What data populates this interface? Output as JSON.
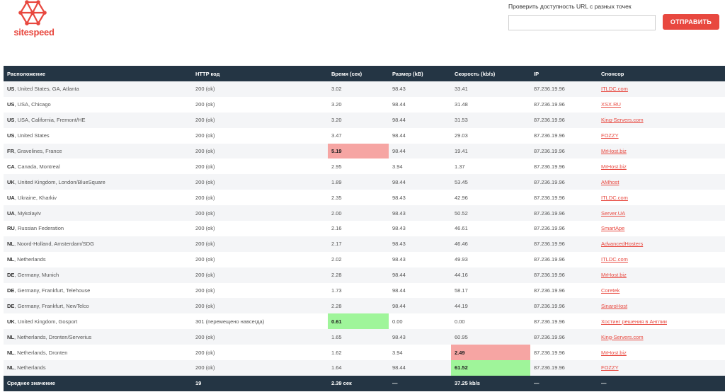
{
  "logo": {
    "text": "sitespeed"
  },
  "check": {
    "label": "Проверить доступность URL с разных точек",
    "input_value": "",
    "input_placeholder": "",
    "button_label": "ОТПРАВИТЬ"
  },
  "colors": {
    "accent": "#e8483f",
    "header_bg": "#243544",
    "highlight_red": "#f6a5a3",
    "highlight_green": "#9ff59a"
  },
  "table": {
    "headers": [
      "Расположение",
      "HTTP код",
      "Время (сек)",
      "Размер (kB)",
      "Скорость (kb/s)",
      "IP",
      "Спонсор"
    ],
    "rows": [
      {
        "cc": "US",
        "loc": ", United States, GA, Atlanta",
        "http": "200 (ok)",
        "time": "3.02",
        "size": "98.43",
        "speed": "33.41",
        "ip": "87.236.19.96",
        "sponsor": "ITLDC.com"
      },
      {
        "cc": "US",
        "loc": ", USA, Chicago",
        "http": "200 (ok)",
        "time": "3.20",
        "size": "98.44",
        "speed": "31.48",
        "ip": "87.236.19.96",
        "sponsor": "XSX.RU"
      },
      {
        "cc": "US",
        "loc": ", USA, California, Fremont/HE",
        "http": "200 (ok)",
        "time": "3.20",
        "size": "98.44",
        "speed": "31.53",
        "ip": "87.236.19.96",
        "sponsor": "King-Servers.com"
      },
      {
        "cc": "US",
        "loc": ", United States",
        "http": "200 (ok)",
        "time": "3.47",
        "size": "98.44",
        "speed": "29.03",
        "ip": "87.236.19.96",
        "sponsor": "FOZZY"
      },
      {
        "cc": "FR",
        "loc": ", Gravelines, France",
        "http": "200 (ok)",
        "time": "5.19",
        "size": "98.44",
        "speed": "19.41",
        "ip": "87.236.19.96",
        "sponsor": "MrHost.biz",
        "time_hl": "red"
      },
      {
        "cc": "CA",
        "loc": ", Canada, Montreal",
        "http": "200 (ok)",
        "time": "2.95",
        "size": "3.94",
        "speed": "1.37",
        "ip": "87.236.19.96",
        "sponsor": "MrHost.biz"
      },
      {
        "cc": "UK",
        "loc": ", United Kingdom, London/BlueSquare",
        "http": "200 (ok)",
        "time": "1.89",
        "size": "98.44",
        "speed": "53.45",
        "ip": "87.236.19.96",
        "sponsor": "AMhost"
      },
      {
        "cc": "UA",
        "loc": ", Ukraine, Kharkiv",
        "http": "200 (ok)",
        "time": "2.35",
        "size": "98.43",
        "speed": "42.96",
        "ip": "87.236.19.96",
        "sponsor": "ITLDC.com"
      },
      {
        "cc": "UA",
        "loc": ", Mykolayiv",
        "http": "200 (ok)",
        "time": "2.00",
        "size": "98.43",
        "speed": "50.52",
        "ip": "87.236.19.96",
        "sponsor": "Server.UA"
      },
      {
        "cc": "RU",
        "loc": ", Russian Federation",
        "http": "200 (ok)",
        "time": "2.16",
        "size": "98.43",
        "speed": "46.61",
        "ip": "87.236.19.96",
        "sponsor": "SmartApe"
      },
      {
        "cc": "NL",
        "loc": ", Noord-Holland, Amsterdam/SDG",
        "http": "200 (ok)",
        "time": "2.17",
        "size": "98.43",
        "speed": "46.46",
        "ip": "87.236.19.96",
        "sponsor": "AdvancedHosters"
      },
      {
        "cc": "NL",
        "loc": ", Netherlands",
        "http": "200 (ok)",
        "time": "2.02",
        "size": "98.43",
        "speed": "49.93",
        "ip": "87.236.19.96",
        "sponsor": "ITLDC.com"
      },
      {
        "cc": "DE",
        "loc": ", Germany, Munich",
        "http": "200 (ok)",
        "time": "2.28",
        "size": "98.44",
        "speed": "44.16",
        "ip": "87.236.19.96",
        "sponsor": "MrHost.biz"
      },
      {
        "cc": "DE",
        "loc": ", Germany, Frankfurt, Telehouse",
        "http": "200 (ok)",
        "time": "1.73",
        "size": "98.44",
        "speed": "58.17",
        "ip": "87.236.19.96",
        "sponsor": "Coretek"
      },
      {
        "cc": "DE",
        "loc": ", Germany, Frankfurt, NewTelco",
        "http": "200 (ok)",
        "time": "2.28",
        "size": "98.44",
        "speed": "44.19",
        "ip": "87.236.19.96",
        "sponsor": "SinaroHost"
      },
      {
        "cc": "UK",
        "loc": ", United Kingdom, Gosport",
        "http": "301 (перемещено навсегда)",
        "time": "0.61",
        "size": "0.00",
        "speed": "0.00",
        "ip": "87.236.19.96",
        "sponsor": "Хостинг решения в Англии",
        "time_hl": "green"
      },
      {
        "cc": "NL",
        "loc": ", Netherlands, Dronten/Serverius",
        "http": "200 (ok)",
        "time": "1.65",
        "size": "98.43",
        "speed": "60.95",
        "ip": "87.236.19.96",
        "sponsor": "King-Servers.com"
      },
      {
        "cc": "NL",
        "loc": ", Netherlands, Dronten",
        "http": "200 (ok)",
        "time": "1.62",
        "size": "3.94",
        "speed": "2.49",
        "ip": "87.236.19.96",
        "sponsor": "MrHost.biz",
        "speed_hl": "red"
      },
      {
        "cc": "NL",
        "loc": ", Netherlands",
        "http": "200 (ok)",
        "time": "1.64",
        "size": "98.44",
        "speed": "61.52",
        "ip": "87.236.19.96",
        "sponsor": "FOZZY",
        "speed_hl": "green"
      }
    ],
    "footer": [
      "Среднее значение",
      "19",
      "2.39 сек",
      "—",
      "37.25 kb/s",
      "—",
      "—"
    ]
  }
}
